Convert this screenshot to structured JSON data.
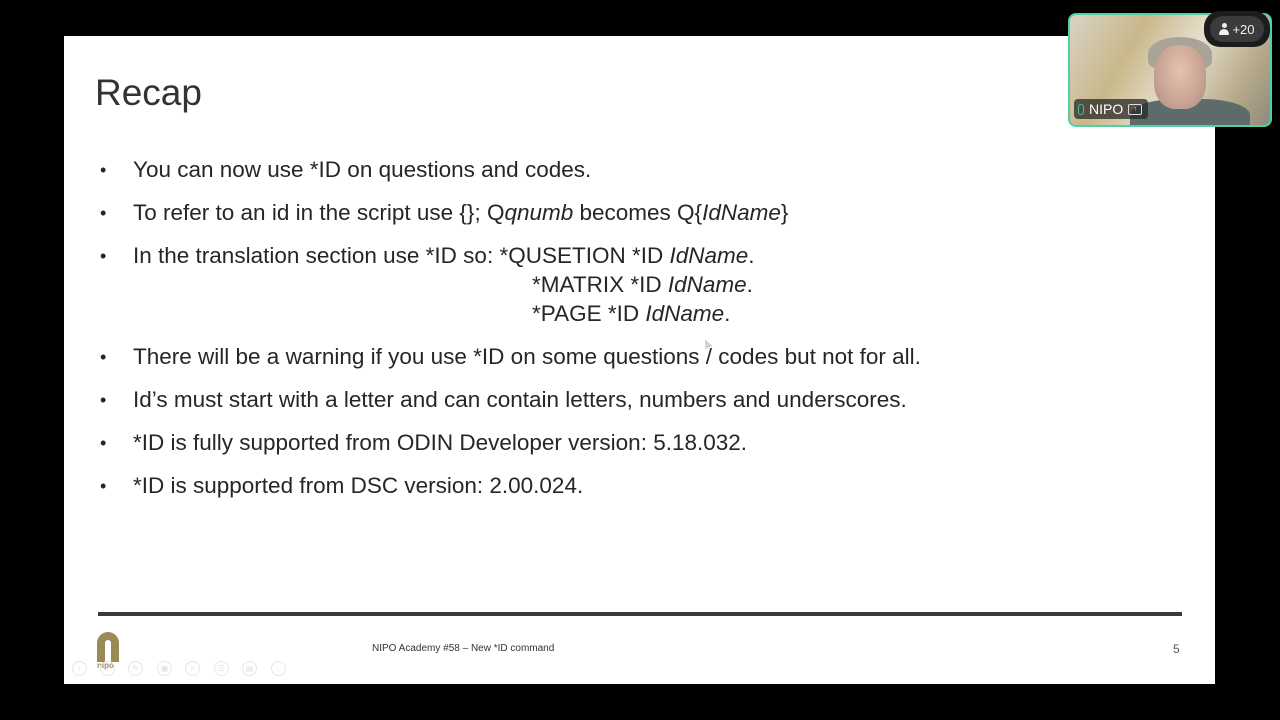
{
  "slide": {
    "title": "Recap",
    "bullets": [
      {
        "parts": [
          "You can now use *ID on questions and codes."
        ]
      },
      {
        "parts": [
          "To refer to an id in the script use {}; Q",
          "qnumb",
          " becomes Q{",
          "IdName",
          "}"
        ]
      },
      {
        "parts": [
          "In the translation section use *ID so:  *QUSETION *ID ",
          "IdName",
          "."
        ],
        "sub_lines": [
          {
            "parts": [
              "*MATRIX *ID ",
              "IdName",
              "."
            ]
          },
          {
            "parts": [
              "*PAGE *ID ",
              "IdName",
              "."
            ]
          }
        ]
      },
      {
        "parts": [
          "There will be a warning if you use *ID on some questions / codes but not for all."
        ]
      },
      {
        "parts": [
          "Id’s must start with a letter and can contain letters, numbers and underscores."
        ]
      },
      {
        "parts": [
          "*ID is fully supported from ODIN Developer version: 5.18.032."
        ]
      },
      {
        "parts": [
          "*ID is supported from DSC version: 2.00.024."
        ]
      }
    ],
    "bullet_glyph": "•",
    "footer_text": "NIPO Academy #58 – New *ID command",
    "page_number": "5",
    "logo_text": "nipo",
    "logo_color": "#9a8a55"
  },
  "presenter_controls": [
    {
      "name": "previous-slide",
      "glyph": "‹"
    },
    {
      "name": "next-slide",
      "glyph": "›"
    },
    {
      "name": "pen",
      "glyph": "✎"
    },
    {
      "name": "slides-view",
      "glyph": "▣"
    },
    {
      "name": "zoom",
      "glyph": "⌕"
    },
    {
      "name": "subtitles",
      "glyph": "☰"
    },
    {
      "name": "camera",
      "glyph": "▤"
    },
    {
      "name": "more-options",
      "glyph": "…"
    }
  ],
  "meeting": {
    "participant_name": "NIPO",
    "participants_extra": "+20",
    "accent_color": "#4fd1a5"
  }
}
